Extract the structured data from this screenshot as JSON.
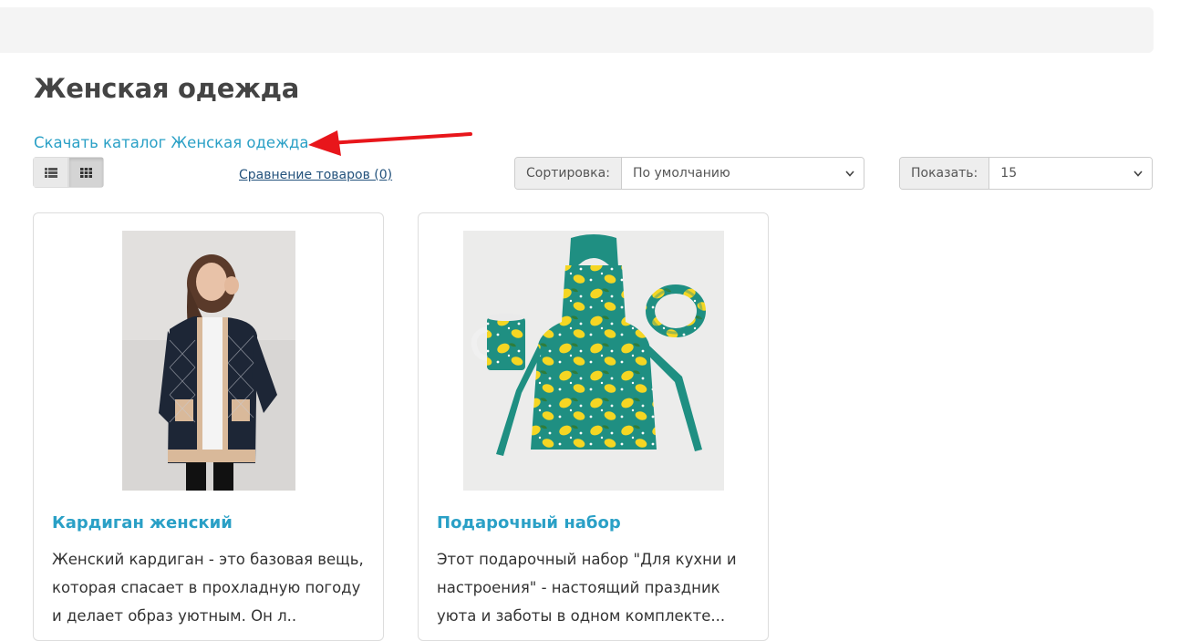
{
  "page": {
    "title": "Женская одежда",
    "catalog_link": "Скачать каталог Женская одежда"
  },
  "toolbar": {
    "compare_link": "Сравнение товаров (0)",
    "sort_label": "Сортировка:",
    "sort_value": "По умолчанию",
    "limit_label": "Показать:",
    "limit_value": "15",
    "view_mode": "grid"
  },
  "products": [
    {
      "name": "Кардиган женский",
      "description": "Женский кардиган - это базовая вещь, которая спасает в прохладную погоду и делает образ уютным. Он л.."
    },
    {
      "name": "Подарочный набор",
      "description": "Этот подарочный набор \"Для кухни и настроения\" - настоящий праздник уюта и заботы в одном комплекте..."
    }
  ],
  "colors": {
    "link": "#2aa0c6",
    "annotation_arrow": "#e8161b"
  }
}
